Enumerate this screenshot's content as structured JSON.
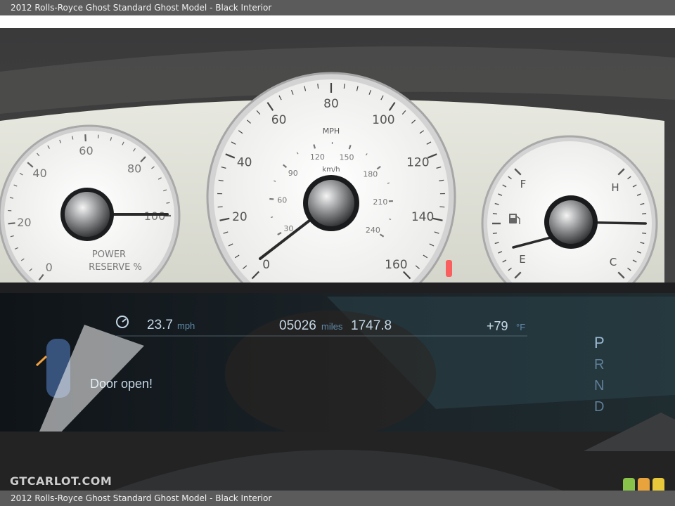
{
  "caption": {
    "top": "2012 Rolls-Royce Ghost Standard Ghost Model - Black Interior",
    "bottom": "2012 Rolls-Royce Ghost Standard Ghost Model - Black Interior"
  },
  "watermark": "GTCARLOT.COM",
  "gauges": {
    "power_reserve": {
      "ticks": [
        "0",
        "20",
        "40",
        "60",
        "80",
        "100"
      ],
      "label_line1": "POWER",
      "label_line2": "RESERVE %",
      "needle_value": 100
    },
    "speedometer": {
      "mph_ticks": [
        "0",
        "20",
        "40",
        "60",
        "80",
        "100",
        "120",
        "140",
        "160"
      ],
      "kmh_ticks": [
        "30",
        "60",
        "90",
        "120",
        "150",
        "180",
        "210",
        "240"
      ],
      "mph_unit": "MPH",
      "kmh_unit": "km/h",
      "needle_value_mph": 0
    },
    "fuel_temp": {
      "fuel_full": "F",
      "fuel_empty": "E",
      "temp_hot": "H",
      "temp_cold": "C",
      "fuel_icon": "fuel-pump-icon"
    }
  },
  "display": {
    "avg_speed_value": "23.7",
    "avg_speed_unit": "mph",
    "odometer_value": "05026",
    "odometer_unit": "miles",
    "trip_value": "1747.8",
    "outside_temp": "+79",
    "temp_unit": "°F",
    "door_message": "Door open!",
    "gears": [
      "P",
      "R",
      "N",
      "D"
    ],
    "selected_gear": "P"
  },
  "colors": {
    "dial_face": "#f3f3f0",
    "bezel": "#d9d9d9",
    "panel_cream": "#dfe0d6",
    "display_text": "#c5d8e6",
    "needle": "#2a2a2a",
    "badge_green": "#88c34a",
    "badge_orange": "#e8a33c",
    "badge_yellow": "#e6c83a"
  }
}
